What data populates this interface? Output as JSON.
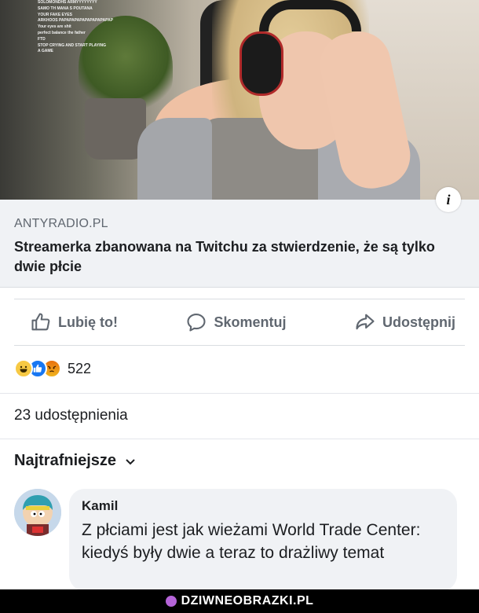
{
  "stream_chat": [
    "SOLOMONDHS ARMYYYYYYYY",
    "SAMO TH MANA S POUTANA",
    "YOUR FAKE EYES",
    "ARKHOOS PAPAPAPAPAPAPAPAPAPAP",
    "Your eyes are shit",
    "perfect balance the father",
    "FTD",
    "STOP CRYING AND START PLAYING",
    "A GAME"
  ],
  "link_preview": {
    "domain": "ANTYRADIO.PL",
    "headline": "Streamerka zbanowana na Twitchu za stwierdzenie, że są tylko dwie płcie",
    "info_icon": "i"
  },
  "actions": {
    "like_label": "Lubię to!",
    "comment_label": "Skomentuj",
    "share_label": "Udostępnij"
  },
  "reactions": {
    "count": "522",
    "types": [
      "haha",
      "like",
      "angry"
    ]
  },
  "shares_text": "23 udostępnienia",
  "sort_label": "Najtrafniejsze",
  "comment": {
    "author": "Kamil",
    "text": "Z płciami jest jak  wieżami World Trade Center: kiedyś były dwie a teraz to drażliwy temat"
  },
  "footer": {
    "watermark": "DZIWNEOBRAZKI.PL"
  },
  "colors": {
    "link_box_bg": "#f0f2f5",
    "text_primary": "#1c1e21",
    "text_secondary": "#606770",
    "like_blue": "#1877f2",
    "haha_yellow": "#f7c944"
  }
}
